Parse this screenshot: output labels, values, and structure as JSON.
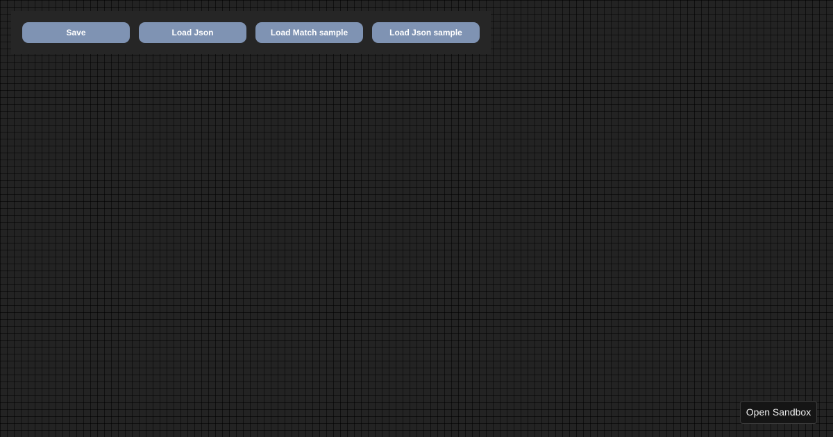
{
  "toolbar": {
    "buttons": [
      {
        "label": "Save"
      },
      {
        "label": "Load Json"
      },
      {
        "label": "Load Match sample"
      },
      {
        "label": "Load Json sample"
      }
    ],
    "button_color": "#7f93b3"
  },
  "sandbox": {
    "label": "Open Sandbox"
  },
  "canvas": {
    "background_color": "#232323",
    "grid": true
  }
}
